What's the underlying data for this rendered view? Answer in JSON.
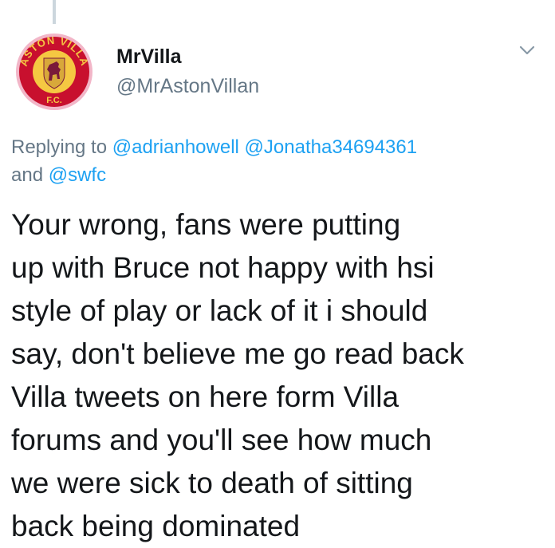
{
  "user": {
    "display_name": "MrVilla",
    "handle": "@MrAstonVillan",
    "avatar": {
      "badge_top_text": "ASTON VILLA",
      "badge_bottom_text": "F.C.",
      "colors": {
        "ring": "#f2b6c8",
        "outer": "#c8102e",
        "inner": "#f5c842",
        "lion": "#7a1a3a",
        "shield": "#d8a83a"
      }
    }
  },
  "menu_icon": "chevron-down-icon",
  "reply": {
    "prefix": "Replying to",
    "mention_1": "@adrianhowell",
    "mention_2": "@Jonatha34694361",
    "conjunction": "and",
    "mention_3": "@swfc"
  },
  "tweet": {
    "lines": [
      "Your wrong, fans were putting",
      "up with Bruce not happy with hsi",
      "style of play or lack of it i should",
      "say, don't believe me go read back",
      "Villa tweets on here form Villa",
      "forums and you'll see how much",
      "we were sick to death of sitting",
      "back being dominated"
    ]
  },
  "colors": {
    "link": "#1da1f2",
    "secondary_text": "#657786",
    "primary_text": "#14171a",
    "thread_line": "#ccd6dd"
  }
}
